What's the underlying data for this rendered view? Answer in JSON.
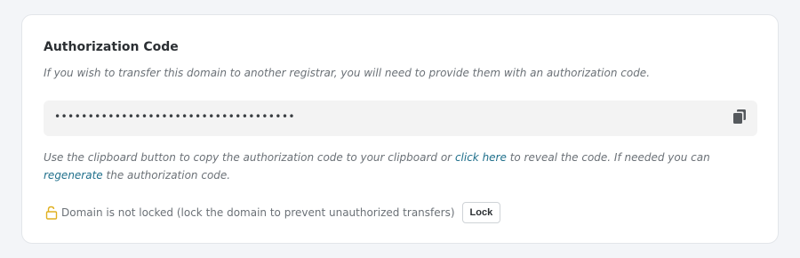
{
  "section": {
    "title": "Authorization Code",
    "description": "If you wish to transfer this domain to another registrar, you will need to provide them with an authorization code."
  },
  "auth_code": {
    "masked_value": "••••••••••••••••••••••••••••••••••••",
    "copy_icon": "clipboard-copy-icon"
  },
  "help": {
    "part1": "Use the clipboard button to copy the authorization code to your clipboard or ",
    "reveal_link": "click here",
    "part2": " to reveal the code. If needed you can ",
    "regenerate_link": "regenerate",
    "part3": " the authorization code."
  },
  "lock_status": {
    "icon": "unlocked-padlock-icon",
    "text": "Domain is not locked (lock the domain to prevent unauthorized transfers)",
    "button_label": "Lock"
  },
  "colors": {
    "link": "#1f6f8b",
    "lock_icon": "#e0b020",
    "background": "#f3f5f8"
  }
}
